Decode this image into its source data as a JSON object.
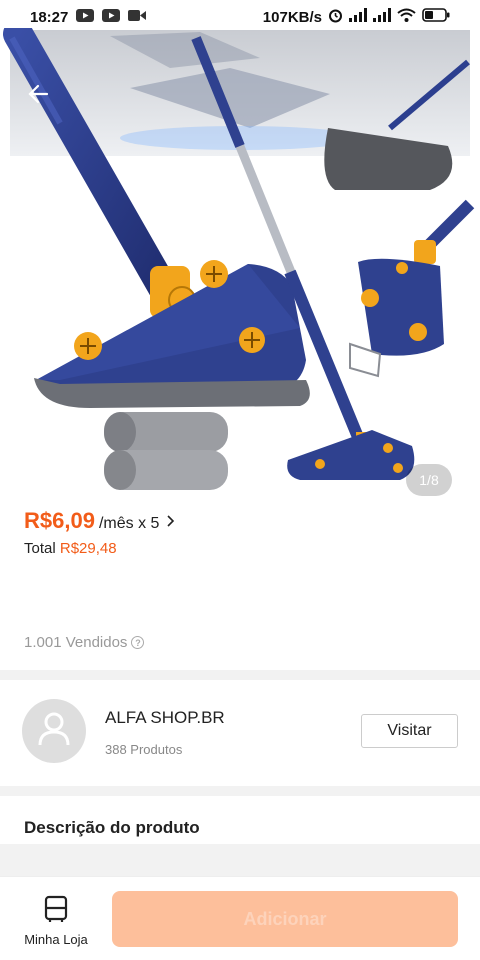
{
  "status_bar": {
    "time": "18:27",
    "network_speed": "107KB/s"
  },
  "gallery": {
    "page_indicator": "1/8",
    "image_description_icon": "mop-product-image"
  },
  "pricing": {
    "installment_price": "R$6,09",
    "installment_terms": "/mês x 5",
    "total_label": "Total",
    "total_value": "R$29,48",
    "sold_count": "1.001 Vendidos"
  },
  "store": {
    "name": "ALFA SHOP.BR",
    "products_count": "388 Produtos",
    "visit_label": "Visitar"
  },
  "description": {
    "title": "Descrição do produto"
  },
  "bottom_bar": {
    "store_tab_label": "Minha Loja",
    "add_button_label": "Adicionar"
  },
  "colors": {
    "price_accent": "#f25c19",
    "add_button_bg": "#fdbf9b",
    "product_navy": "#2c3f8f",
    "product_orange": "#f2a51c"
  }
}
